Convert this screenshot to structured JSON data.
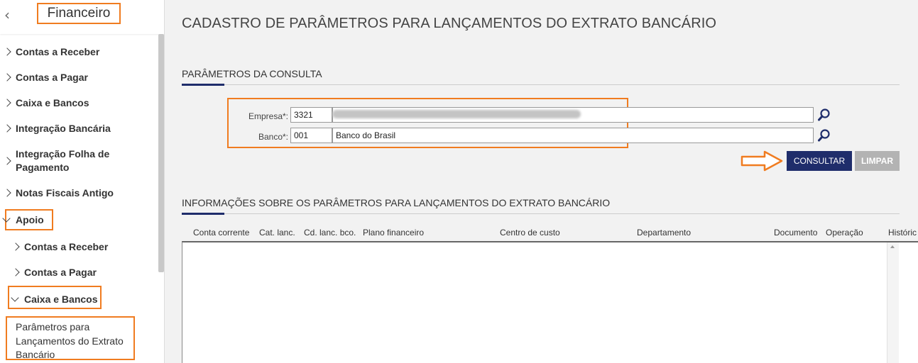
{
  "sidebar": {
    "back_icon": "chevron-left-icon",
    "title": "Financeiro",
    "items": [
      {
        "label": "Contas a Receber",
        "expanded": false
      },
      {
        "label": "Contas a Pagar",
        "expanded": false
      },
      {
        "label": "Caixa e Bancos",
        "expanded": false
      },
      {
        "label": "Integração Bancária",
        "expanded": false
      },
      {
        "label": "Integração Folha de Pagamento",
        "expanded": false
      },
      {
        "label": "Notas Fiscais Antigo",
        "expanded": false
      },
      {
        "label": "Apoio",
        "expanded": true,
        "children": [
          {
            "label": "Contas a Receber",
            "expanded": false
          },
          {
            "label": "Contas a Pagar",
            "expanded": false
          },
          {
            "label": "Caixa e Bancos",
            "expanded": true,
            "children": [
              {
                "label": "Parâmetros para Lançamentos do Extrato Bancário"
              }
            ]
          }
        ]
      }
    ]
  },
  "page": {
    "title": "CADASTRO DE PARÂMETROS PARA LANÇAMENTOS DO EXTRATO BANCÁRIO"
  },
  "query_section": {
    "title": "PARÂMETROS DA CONSULTA",
    "empresa": {
      "label": "Empresa*:",
      "code": "3321",
      "name": ""
    },
    "banco": {
      "label": "Banco*:",
      "code": "001",
      "name": "Banco do Brasil"
    },
    "search_icon": "magnifier-icon",
    "consultar_label": "CONSULTAR",
    "limpar_label": "LIMPAR"
  },
  "info_section": {
    "title": "INFORMAÇÕES SOBRE OS PARÂMETROS PARA LANÇAMENTOS DO EXTRATO BANCÁRIO",
    "columns": [
      "Conta corrente",
      "Cat. lanc.",
      "Cd. lanc. bco.",
      "Plano financeiro",
      "Centro de custo",
      "Departamento",
      "Documento",
      "Operação",
      "Históric"
    ],
    "rows": []
  },
  "colors": {
    "accent": "#1f2d6b",
    "highlight": "#f07c20",
    "disabled": "#b3b3b3"
  }
}
